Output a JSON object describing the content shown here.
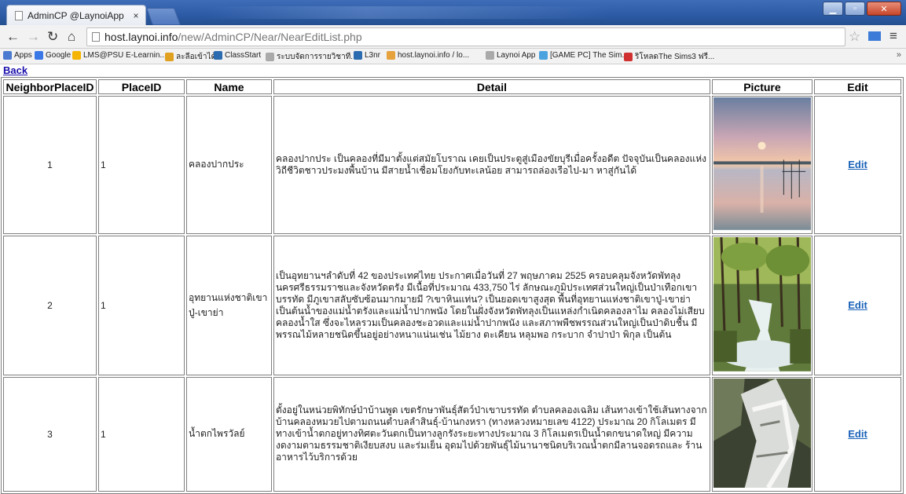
{
  "browser": {
    "tab_title": "AdminCP @LaynoiApp",
    "tab_close": "×",
    "url_host": "host.laynoi.info",
    "url_path": "/new/AdminCP/Near/NearEditList.php",
    "bookmarks": [
      {
        "label": "Apps",
        "color": "#4a7bd0"
      },
      {
        "label": "Google",
        "color": "#3b78e7"
      },
      {
        "label": "LMS@PSU E-Learnin...",
        "color": "#f4b400"
      },
      {
        "label": "ละลีอเข้าได้",
        "color": "#e0a020"
      },
      {
        "label": "ClassStart",
        "color": "#2b6cb0"
      },
      {
        "label": "ระบบจัดการรายวิชาที...",
        "color": "#aaaaaa"
      },
      {
        "label": "L3nr",
        "color": "#2b6cb0"
      },
      {
        "label": "host.laynoi.info / lo...",
        "color": "#e6a23c"
      },
      {
        "label": "Laynoi App",
        "color": "#aaaaaa"
      },
      {
        "label": "[GAME PC] The Sim...",
        "color": "#4aa3df"
      },
      {
        "label": "ริโหลดThe Sims3 ฟรี...",
        "color": "#d03030"
      }
    ],
    "bookmarks_more": "»"
  },
  "page": {
    "back_label": "Back",
    "columns": [
      "NeighborPlaceID",
      "PlaceID",
      "Name",
      "Detail",
      "Picture",
      "Edit"
    ],
    "rows": [
      {
        "neighbor_id": "1",
        "place_id": "1",
        "name": "คลองปากประ",
        "detail": "คลองปากประ เป็นคลองที่มีมาตั้งแต่สมัยโบราณ เคยเป็นประตูสู่เมืองขัยบุรีเมื่อครั้งอดีต ปัจจุบันเป็นคลองแห่งวิถีชีวิตชาวประมงพื้นบ้าน มีสายน้ำเชื่อมโยงกับทะเลน้อย สามารถล่องเรือไป-มา หาสู่กันได้",
        "picture": "sunset-lake-photo",
        "edit": "Edit"
      },
      {
        "neighbor_id": "2",
        "place_id": "1",
        "name": "อุทยานแห่งชาติเขาปู่-เขาย่า",
        "detail": "เป็นอุทยานฯลำดับที่ 42 ของประเทศไทย ประกาศเมื่อวันที่ 27 พฤษภาคม 2525 ครอบคลุมจังหวัดพัทลุง นครศรีธรรมราชและจังหวัดตรัง มีเนื้อที่ประมาณ 433,750 ไร่ ลักษณะภูมิประเทศส่วนใหญ่เป็นป่าเทือกเขาบรรทัด มีภูเขาสลับซับซ้อนมากมายมี ?เขาหินแท่น? เป็นยอดเขาสูงสุด พื้นที่อุทยานแห่งชาติเขาปู่-เขาย่า เป็นต้นน้ำของแม่น้ำตรังและแม่น้ำปากพนัง โดยในฝั่งจังหวัดพัทลุงเป็นแหล่งกำเนิดคลองลาไม คลองไม่เสียบ คลองน้ำใส ซึ่งจะไหลรวมเป็นคลองชะอวดและแม่น้ำปากพนัง และสภาพพืชพรรณส่วนใหญ่เป็นป่าดิบชื้น มีพรรณไม้หลายชนิดขึ้นอยู่อย่างหนาแน่นเช่น ไม้ยาง ตะเคียน หลุมพอ กระบาก จำปาป่า พิกุล เป็นต้น",
        "picture": "forest-waterfall-photo",
        "edit": "Edit"
      },
      {
        "neighbor_id": "3",
        "place_id": "1",
        "name": "น้ำตกไพรวัลย์",
        "detail": "ตั้งอยู่ในหน่วยพิทักษ์ป่าบ้านพูด เขตรักษาพันธุ์สัตว์ป่าเขาบรรทัด ตำบลคลองเฉลิม เส้นทางเข้าใช้เส้นทางจากบ้านคลองหมวยไปตามถนนตำบลลำสินธุ์-บ้านกงหรา (ทางหลวงหมายเลข 4122) ประมาณ 20 กิโลเมตร มีทางเข้าน้ำตกอยู่ทางทิศตะวันตกเป็นทางลูกรังระยะทางประมาณ 3 กิโลเมตรเป็นน้ำตกขนาดใหญ่ มีความงดงามตามธรรมชาติเงียบสงบ และร่มเย็น อุดมไปด้วยพันธุ์ไม้นานาชนิดบริเวณน้ำตกมีลานจอดรถและ ร้านอาหารไว้บริการด้วย",
        "picture": "rock-waterfall-photo",
        "edit": "Edit"
      }
    ]
  }
}
